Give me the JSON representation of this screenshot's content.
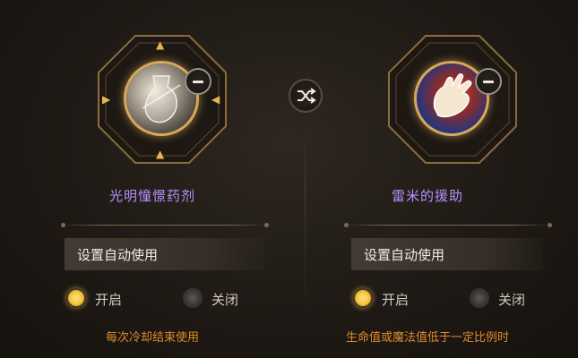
{
  "swap_icon": "shuffle-icon",
  "colors": {
    "skill_name": "#b790ff",
    "note": "#e08a2e",
    "radio_on": "#f6c440",
    "frame_gold": "#d8a85a"
  },
  "slots": [
    {
      "icon": "potion-bottle-icon",
      "badge_icon": "minus-icon",
      "name": "光明憧憬药剂",
      "auto_use_label": "设置自动使用",
      "option_on": "开启",
      "option_off": "关闭",
      "selected": "开启",
      "note": "每次冷却结束使用",
      "has_move_arrows": true
    },
    {
      "icon": "hand-icon",
      "badge_icon": "minus-icon",
      "name": "雷米的援助",
      "auto_use_label": "设置自动使用",
      "option_on": "开启",
      "option_off": "关闭",
      "selected": "开启",
      "note": "生命值或魔法值低于一定比例时",
      "has_move_arrows": false
    }
  ]
}
